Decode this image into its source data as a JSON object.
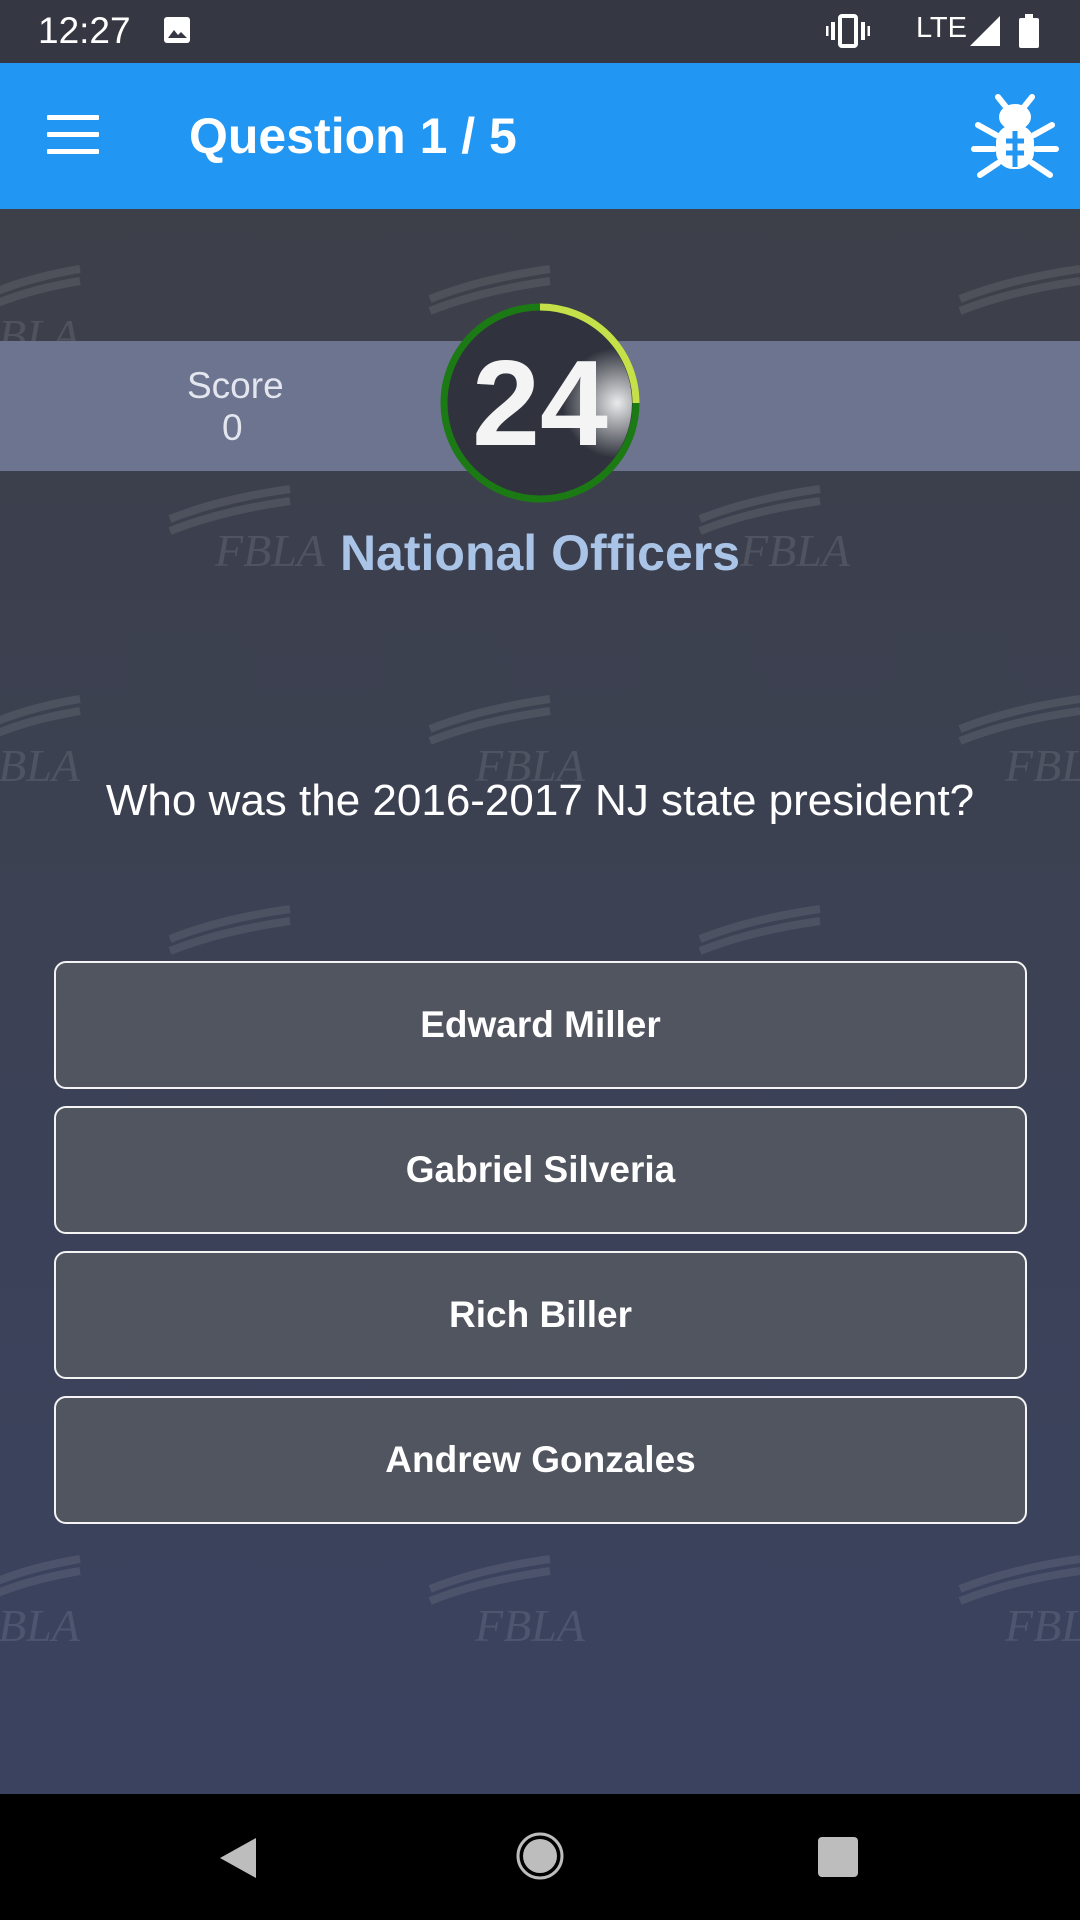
{
  "status_bar": {
    "time": "12:27",
    "network": "LTE",
    "icons": [
      "image-icon",
      "vibrate-icon",
      "signal-icon",
      "battery-icon"
    ]
  },
  "app_bar": {
    "title": "Question 1 / 5",
    "menu_icon": "menu-icon",
    "action_icon": "bug-icon",
    "color": "#2196f3"
  },
  "score": {
    "label": "Score",
    "value": "0"
  },
  "timer": {
    "seconds": "24",
    "ring_color": "#1b7a14",
    "accent_color": "#c6e04a"
  },
  "quiz": {
    "category": "National Officers",
    "question": "Who was the 2016-2017 NJ state president?",
    "answers": [
      "Edward Miller",
      "Gabriel Silveria",
      "Rich Biller",
      "Andrew Gonzales"
    ]
  },
  "background": {
    "watermark_text": "FBLA"
  },
  "nav_bar": {
    "icons": [
      "back-icon",
      "home-icon",
      "recents-icon"
    ]
  }
}
